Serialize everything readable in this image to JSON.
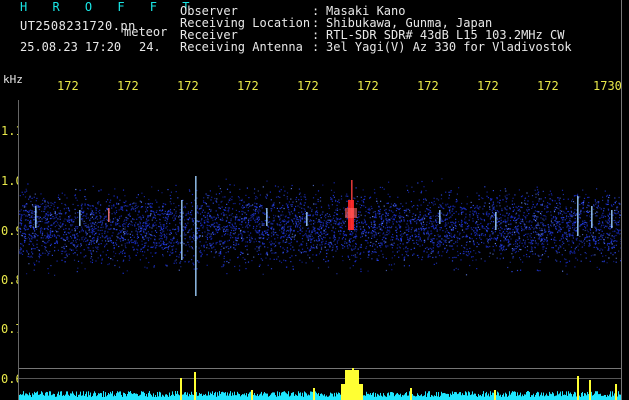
{
  "header": {
    "app_name": "H R O F F T",
    "filename": "UT2508231720.pn",
    "mode": "meteor",
    "date": "25.08.23 17:20",
    "sequence": "24.",
    "fields": [
      {
        "label": "Observer",
        "value": "Masaki Kano"
      },
      {
        "label": "Receiving Location",
        "value": "Shibukawa, Gunma, Japan"
      },
      {
        "label": "Receiver",
        "value": "RTL-SDR SDR# 43dB L15 103.2MHz CW"
      },
      {
        "label": "Receiving Antenna",
        "value": "3el Yagi(V) Az 330 for Vladivostok"
      }
    ]
  },
  "axis": {
    "unit": "kHz",
    "time_ticks": [
      "172",
      "172",
      "172",
      "172",
      "172",
      "172",
      "172",
      "172",
      "172",
      "1730"
    ],
    "freq_labels": [
      "1.1",
      "1.0",
      "0.9",
      "0.8",
      "0.7",
      "0.6"
    ]
  },
  "colors": {
    "background": "#000000",
    "title": "#19e6e6",
    "text": "#e8e8e8",
    "axis_text": "#e8e84a",
    "noise_blue": "#1a2fd6",
    "echo_red": "#ff2a2a",
    "signal_bar": "#1ee6ff",
    "peak_bar": "#ffff33"
  }
}
